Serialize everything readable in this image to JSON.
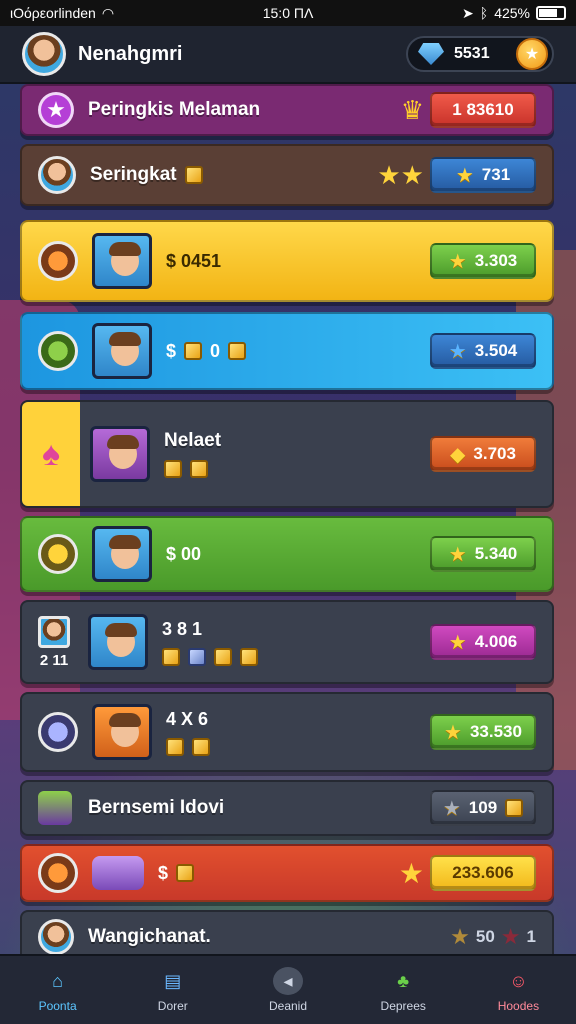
{
  "statusbar": {
    "carrier": "ιΟόρεοrlinden",
    "time": "15:0 ΠΛ",
    "battery": "425%"
  },
  "header": {
    "player_name": "Nenahgmri",
    "currency_value": "5531"
  },
  "rows": [
    {
      "label": "Peringkis Melaman",
      "value": "1 83610",
      "color": "#8a2d7c"
    },
    {
      "label": "Seringkat",
      "value": "731",
      "color": "#6a4a3a"
    },
    {
      "amount": "$ 0451",
      "value": "3.303",
      "color": "#f7c21a"
    },
    {
      "amount": "$",
      "amount_suffix": "0",
      "value": "3.504",
      "color": "#22a6e8"
    },
    {
      "label": "Nelaet",
      "value": "3.703",
      "color": "#3a404e",
      "accent": "#ffd23a"
    },
    {
      "amount": "$ 00",
      "value": "5.340",
      "color": "#5aa832"
    },
    {
      "side_label": "2 11",
      "amount": "3 8 1",
      "value": "4.006",
      "color": "#3a404e"
    },
    {
      "amount": "4 X 6",
      "value": "33.530",
      "color": "#3a404e"
    },
    {
      "label": "Bernsemi Idovi",
      "value": "109",
      "color": "#3a404e"
    },
    {
      "amount": "$",
      "value": "233.606",
      "color": "#d8432e"
    },
    {
      "label": "Wangichanat.",
      "value": "50",
      "suffix": "1",
      "color": "#3a404e"
    }
  ],
  "tabs": [
    {
      "label": "Poonta",
      "icon": "home-icon",
      "active": true
    },
    {
      "label": "Dorer",
      "icon": "shop-icon"
    },
    {
      "label": "Deanid",
      "icon": "chat-icon"
    },
    {
      "label": "Deprees",
      "icon": "clover-icon"
    },
    {
      "label": "Hoodes",
      "icon": "profile-icon"
    }
  ]
}
